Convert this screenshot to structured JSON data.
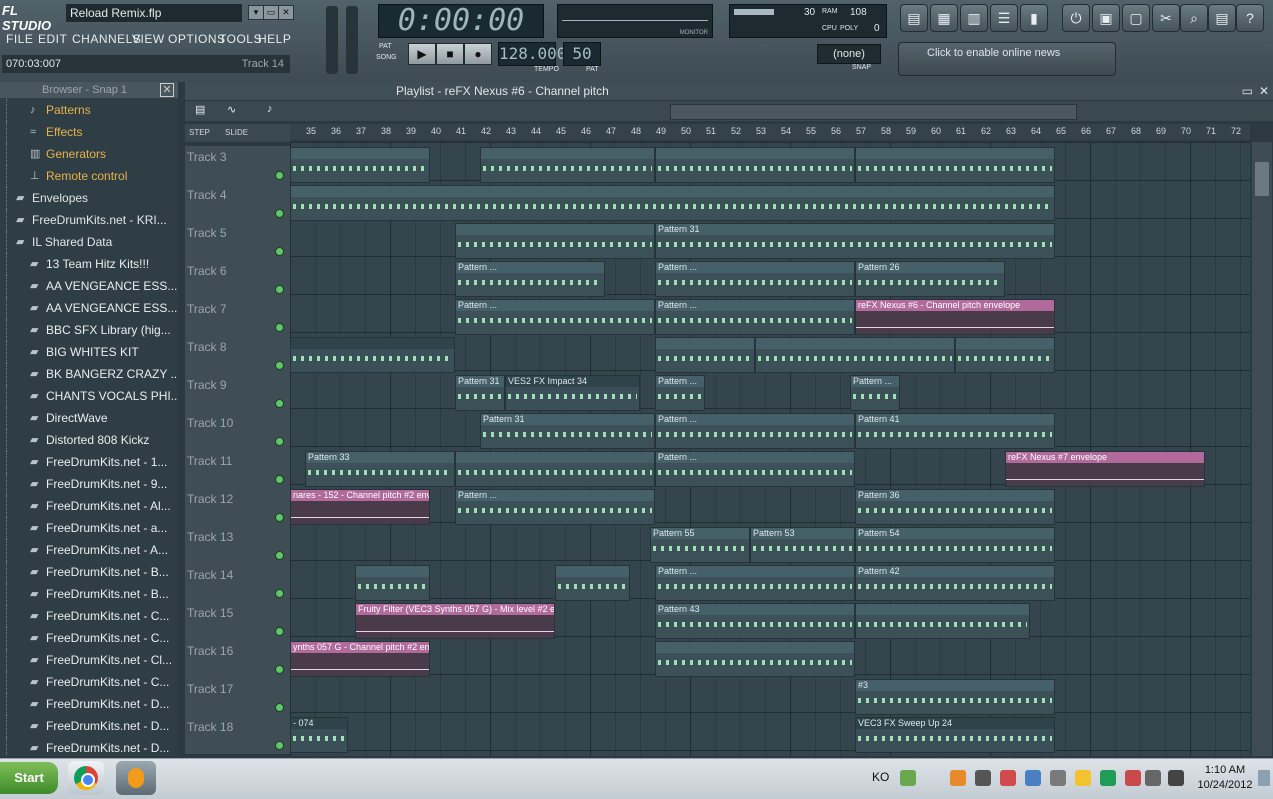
{
  "app": {
    "logo": "FL STUDIO",
    "file_name": "Reload Remix.flp"
  },
  "menu": [
    "FILE",
    "EDIT",
    "CHANNELS",
    "VIEW",
    "OPTIONS",
    "TOOLS",
    "HELP"
  ],
  "hint_bar": {
    "position": "070:03:007",
    "track": "Track 14"
  },
  "transport": {
    "time": "0:00:00",
    "tempo": "128.000",
    "pattern": "50",
    "pat_label": "PAT",
    "song_label": "SONG",
    "tempo_label": "TEMPO",
    "pat_num_label": "PAT"
  },
  "meters": {
    "cpu_value": "30",
    "poly_value": "108",
    "ram_label": "RAM",
    "cpu_label": "CPU",
    "poly_label": "POLY",
    "zero": "0",
    "monitor_label": "MONITOR"
  },
  "snap": {
    "value": "(none)",
    "label": "SNAP"
  },
  "news": {
    "text": "Click to enable online news"
  },
  "browser": {
    "title": "Browser - Snap 1",
    "items": [
      {
        "label": "Patterns",
        "icon": "note-icon",
        "type": "cat"
      },
      {
        "label": "Effects",
        "icon": "wave-icon",
        "type": "cat"
      },
      {
        "label": "Generators",
        "icon": "piano-icon",
        "type": "cat"
      },
      {
        "label": "Remote control",
        "icon": "plug-icon",
        "type": "cat"
      },
      {
        "label": "Envelopes",
        "icon": "folder-icon",
        "type": "folder"
      },
      {
        "label": "FreeDrumKits.net - KRI...",
        "icon": "folder-icon",
        "type": "folder"
      },
      {
        "label": "IL Shared Data",
        "icon": "folder-icon",
        "type": "folder"
      },
      {
        "label": "13 Team Hitz Kits!!!",
        "icon": "folder-icon",
        "type": "sub"
      },
      {
        "label": "AA VENGEANCE ESS...",
        "icon": "folder-icon",
        "type": "sub"
      },
      {
        "label": "AA VENGEANCE ESS...",
        "icon": "folder-icon",
        "type": "sub"
      },
      {
        "label": "BBC SFX Library (hig...",
        "icon": "folder-icon",
        "type": "sub"
      },
      {
        "label": "BIG WHITES KIT",
        "icon": "folder-icon",
        "type": "sub"
      },
      {
        "label": "BK BANGERZ CRAZY ...",
        "icon": "folder-icon",
        "type": "sub"
      },
      {
        "label": "CHANTS VOCALS PHI...",
        "icon": "folder-icon",
        "type": "sub"
      },
      {
        "label": "DirectWave",
        "icon": "folder-icon",
        "type": "sub"
      },
      {
        "label": "Distorted 808 Kickz",
        "icon": "folder-icon",
        "type": "sub"
      },
      {
        "label": "FreeDrumKits.net - 1...",
        "icon": "folder-icon",
        "type": "sub"
      },
      {
        "label": "FreeDrumKits.net - 9...",
        "icon": "folder-icon",
        "type": "sub"
      },
      {
        "label": "FreeDrumKits.net - Al...",
        "icon": "folder-icon",
        "type": "sub"
      },
      {
        "label": "FreeDrumKits.net - a...",
        "icon": "folder-icon",
        "type": "sub"
      },
      {
        "label": "FreeDrumKits.net - A...",
        "icon": "folder-icon",
        "type": "sub"
      },
      {
        "label": "FreeDrumKits.net - B...",
        "icon": "folder-icon",
        "type": "sub"
      },
      {
        "label": "FreeDrumKits.net - B...",
        "icon": "folder-icon",
        "type": "sub"
      },
      {
        "label": "FreeDrumKits.net - C...",
        "icon": "folder-icon",
        "type": "sub"
      },
      {
        "label": "FreeDrumKits.net - C...",
        "icon": "folder-icon",
        "type": "sub"
      },
      {
        "label": "FreeDrumKits.net - Cl...",
        "icon": "folder-icon",
        "type": "sub"
      },
      {
        "label": "FreeDrumKits.net - C...",
        "icon": "folder-icon",
        "type": "sub"
      },
      {
        "label": "FreeDrumKits.net - D...",
        "icon": "folder-icon",
        "type": "sub"
      },
      {
        "label": "FreeDrumKits.net - D...",
        "icon": "folder-icon",
        "type": "sub"
      },
      {
        "label": "FreeDrumKits.net - D...",
        "icon": "folder-icon",
        "type": "sub"
      }
    ]
  },
  "playlist": {
    "title": "Playlist - reFX Nexus #6 - Channel pitch",
    "step_label": "STEP",
    "slide_label": "SLIDE",
    "ruler": [
      "35",
      "36",
      "37",
      "38",
      "39",
      "40",
      "41",
      "42",
      "43",
      "44",
      "45",
      "46",
      "47",
      "48",
      "49",
      "50",
      "51",
      "52",
      "53",
      "54",
      "55",
      "56",
      "57",
      "58",
      "59",
      "60",
      "61",
      "62",
      "63",
      "64",
      "65",
      "66",
      "67",
      "68",
      "69",
      "70",
      "71",
      "72"
    ],
    "tracks": [
      "Track 3",
      "Track 4",
      "Track 5",
      "Track 6",
      "Track 7",
      "Track 8",
      "Track 9",
      "Track 10",
      "Track 11",
      "Track 12",
      "Track 13",
      "Track 14",
      "Track 15",
      "Track 16",
      "Track 17",
      "Track 18"
    ],
    "clips": [
      {
        "row": 0,
        "start": 0,
        "end": 5.6,
        "label": "",
        "kind": "pattern"
      },
      {
        "row": 0,
        "start": 7.6,
        "end": 14.6,
        "label": "",
        "kind": "pattern"
      },
      {
        "row": 0,
        "start": 14.6,
        "end": 22.6,
        "label": "",
        "kind": "pattern"
      },
      {
        "row": 0,
        "start": 22.6,
        "end": 30.6,
        "label": "",
        "kind": "pattern"
      },
      {
        "row": 1,
        "start": 0,
        "end": 30.6,
        "label": "",
        "kind": "pattern"
      },
      {
        "row": 2,
        "start": 6.6,
        "end": 14.6,
        "label": "",
        "kind": "pattern"
      },
      {
        "row": 2,
        "start": 14.6,
        "end": 30.6,
        "label": "Pattern 31",
        "kind": "pattern"
      },
      {
        "row": 3,
        "start": 6.6,
        "end": 12.6,
        "label": "Pattern ...",
        "kind": "pattern"
      },
      {
        "row": 3,
        "start": 14.6,
        "end": 22.6,
        "label": "Pattern ...",
        "kind": "pattern"
      },
      {
        "row": 3,
        "start": 22.6,
        "end": 28.6,
        "label": "Pattern 26",
        "kind": "pattern"
      },
      {
        "row": 4,
        "start": 6.6,
        "end": 14.6,
        "label": "Pattern ...",
        "kind": "pattern"
      },
      {
        "row": 4,
        "start": 14.6,
        "end": 22.6,
        "label": "Pattern ...",
        "kind": "pattern"
      },
      {
        "row": 4,
        "start": 22.6,
        "end": 30.6,
        "label": "reFX Nexus #6 - Channel pitch envelope",
        "kind": "env"
      },
      {
        "row": 5,
        "start": 0,
        "end": 6.6,
        "label": "",
        "kind": "audio"
      },
      {
        "row": 5,
        "start": 14.6,
        "end": 18.6,
        "label": "",
        "kind": "pattern"
      },
      {
        "row": 5,
        "start": 18.6,
        "end": 26.6,
        "label": "",
        "kind": "pattern"
      },
      {
        "row": 5,
        "start": 26.6,
        "end": 30.6,
        "label": "",
        "kind": "pattern"
      },
      {
        "row": 6,
        "start": 6.6,
        "end": 8.6,
        "label": "Pattern 31",
        "kind": "pattern"
      },
      {
        "row": 6,
        "start": 8.6,
        "end": 14.0,
        "label": "VES2 FX Impact 34",
        "kind": "audio"
      },
      {
        "row": 6,
        "start": 14.6,
        "end": 16.6,
        "label": "Pattern ...",
        "kind": "pattern"
      },
      {
        "row": 6,
        "start": 22.4,
        "end": 24.4,
        "label": "Pattern ...",
        "kind": "pattern"
      },
      {
        "row": 7,
        "start": 7.6,
        "end": 14.6,
        "label": "Pattern 31",
        "kind": "pattern"
      },
      {
        "row": 7,
        "start": 14.6,
        "end": 22.6,
        "label": "Pattern ...",
        "kind": "pattern"
      },
      {
        "row": 7,
        "start": 22.6,
        "end": 30.6,
        "label": "Pattern 41",
        "kind": "pattern"
      },
      {
        "row": 8,
        "start": 0.6,
        "end": 6.6,
        "label": "Pattern 33",
        "kind": "pattern"
      },
      {
        "row": 8,
        "start": 6.6,
        "end": 14.6,
        "label": "",
        "kind": "pattern"
      },
      {
        "row": 8,
        "start": 14.6,
        "end": 22.6,
        "label": "Pattern ...",
        "kind": "pattern"
      },
      {
        "row": 8,
        "start": 28.6,
        "end": 36.6,
        "label": "reFX Nexus #7 envelope",
        "kind": "env"
      },
      {
        "row": 9,
        "start": 0,
        "end": 5.6,
        "label": "nares - 152 - Channel pitch #2 enve...",
        "kind": "env"
      },
      {
        "row": 9,
        "start": 6.6,
        "end": 14.6,
        "label": "Pattern ...",
        "kind": "pattern"
      },
      {
        "row": 9,
        "start": 22.6,
        "end": 30.6,
        "label": "Pattern 36",
        "kind": "pattern"
      },
      {
        "row": 10,
        "start": 14.4,
        "end": 18.4,
        "label": "Pattern 55",
        "kind": "pattern"
      },
      {
        "row": 10,
        "start": 18.4,
        "end": 22.6,
        "label": "Pattern 53",
        "kind": "pattern"
      },
      {
        "row": 10,
        "start": 22.6,
        "end": 30.6,
        "label": "Pattern 54",
        "kind": "pattern"
      },
      {
        "row": 11,
        "start": 2.6,
        "end": 5.6,
        "label": "",
        "kind": "pattern"
      },
      {
        "row": 11,
        "start": 10.6,
        "end": 13.6,
        "label": "",
        "kind": "pattern"
      },
      {
        "row": 11,
        "start": 14.6,
        "end": 22.6,
        "label": "Pattern ...",
        "kind": "pattern"
      },
      {
        "row": 11,
        "start": 22.6,
        "end": 30.6,
        "label": "Pattern 42",
        "kind": "pattern"
      },
      {
        "row": 12,
        "start": 2.6,
        "end": 10.6,
        "label": "Fruity Filter (VEC3 Synths 057 G) - Mix level #2 e...",
        "kind": "env"
      },
      {
        "row": 12,
        "start": 14.6,
        "end": 22.6,
        "label": "Pattern 43",
        "kind": "pattern"
      },
      {
        "row": 12,
        "start": 22.6,
        "end": 29.6,
        "label": "",
        "kind": "pattern"
      },
      {
        "row": 13,
        "start": 0,
        "end": 5.6,
        "label": "ynths 057 G - Channel pitch #2 env...",
        "kind": "env"
      },
      {
        "row": 13,
        "start": 14.6,
        "end": 22.6,
        "label": "",
        "kind": "pattern"
      },
      {
        "row": 14,
        "start": 22.6,
        "end": 30.6,
        "label": "#3",
        "kind": "pattern"
      },
      {
        "row": 15,
        "start": 0,
        "end": 2.3,
        "label": "- 074",
        "kind": "audio"
      },
      {
        "row": 15,
        "start": 22.6,
        "end": 30.6,
        "label": "VEC3 FX Sweep Up 24",
        "kind": "audio"
      }
    ]
  },
  "taskbar": {
    "start": "Start",
    "lang": "KO",
    "time": "1:10 AM",
    "date": "10/24/2012"
  }
}
